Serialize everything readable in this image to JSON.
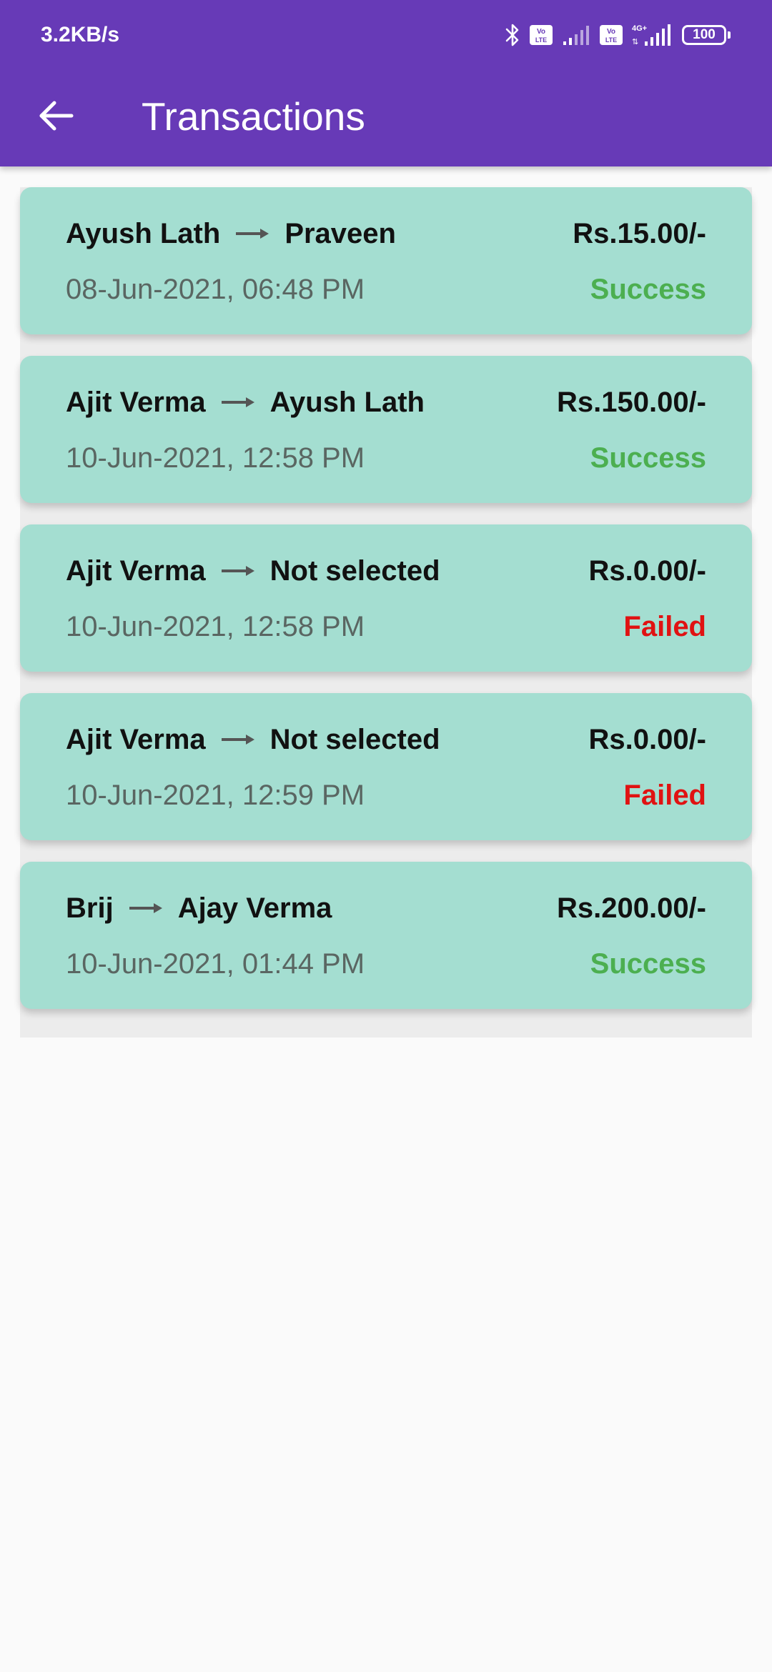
{
  "status_bar": {
    "net_speed": "3.2KB/s",
    "battery": "100",
    "icons": [
      "bluetooth-icon",
      "volte-icon",
      "signal-icon",
      "volte-icon",
      "4g-signal-icon",
      "battery-icon"
    ]
  },
  "toolbar": {
    "title": "Transactions",
    "back_icon": "arrow-back-icon"
  },
  "colors": {
    "app_bar": "#673ab7",
    "card": "#a4ded1",
    "success": "#4caf50",
    "failed": "#e01212"
  },
  "transactions": [
    {
      "from": "Ayush Lath",
      "to": "Praveen",
      "amount": "Rs.15.00/-",
      "date": "08-Jun-2021, 06:48 PM",
      "status": "Success"
    },
    {
      "from": "Ajit Verma",
      "to": "Ayush Lath",
      "amount": "Rs.150.00/-",
      "date": "10-Jun-2021, 12:58 PM",
      "status": "Success"
    },
    {
      "from": "Ajit Verma",
      "to": "Not selected",
      "amount": "Rs.0.00/-",
      "date": "10-Jun-2021, 12:58 PM",
      "status": "Failed"
    },
    {
      "from": "Ajit Verma",
      "to": "Not selected",
      "amount": "Rs.0.00/-",
      "date": "10-Jun-2021, 12:59 PM",
      "status": "Failed"
    },
    {
      "from": "Brij",
      "to": "Ajay Verma",
      "amount": "Rs.200.00/-",
      "date": "10-Jun-2021, 01:44 PM",
      "status": "Success"
    }
  ]
}
